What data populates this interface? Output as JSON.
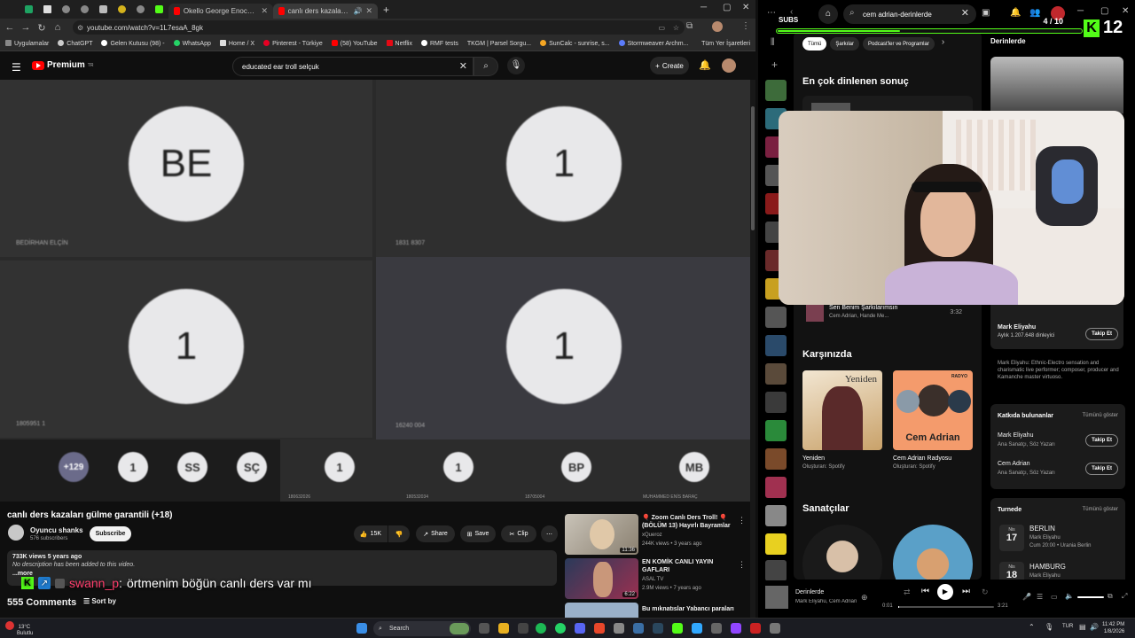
{
  "browser": {
    "tabs": [
      {
        "label": "Okello George Enock - YouTub"
      },
      {
        "label": "canlı ders kazaları gülme g"
      }
    ],
    "url": "youtube.com/watch?v=1L7esaA_8gk",
    "bookmarks": [
      "Uygulamalar",
      "ChatGPT",
      "Gelen Kutusu (98) -",
      "WhatsApp",
      "Home / X",
      "Pinterest - Türkiye",
      "(58) YouTube",
      "Netflix",
      "RMF tests",
      "TKGM | Parsel Sorgu...",
      "SunCalc - sunrise, s...",
      "Stormweaver Archm...",
      "Tüm Yer İşaretleri"
    ]
  },
  "youtube": {
    "logo": "Premium",
    "logo_sup": "TR",
    "search_value": "educated ear troll selçuk",
    "create_label": "Create",
    "meeting": {
      "tiles": [
        {
          "initials": "BE",
          "name": "BEDİRHAN ELÇİN"
        },
        {
          "initials": "1",
          "name": "1831 8307"
        },
        {
          "initials": "1",
          "name": "1805951 1"
        },
        {
          "initials": "1",
          "name": "16240 004"
        }
      ],
      "strip": [
        {
          "initials": "+129",
          "name": ""
        },
        {
          "initials": "1",
          "name": ""
        },
        {
          "initials": "SS",
          "name": ""
        },
        {
          "initials": "SÇ",
          "name": ""
        },
        {
          "initials": "1",
          "name": "180632026"
        },
        {
          "initials": "1",
          "name": "180532034"
        },
        {
          "initials": "BP",
          "name": "18705004"
        },
        {
          "initials": "MB",
          "name": "MUHAMMED ENİS BARAÇ"
        }
      ]
    },
    "video_title": "canlı ders kazaları gülme garantili (+18)",
    "channel_name": "Oyuncu shanks",
    "channel_subs": "576 subscribers",
    "subscribe_label": "Subscribe",
    "like_count": "15K",
    "share_label": "Share",
    "save_label": "Save",
    "clip_label": "Clip",
    "desc_stats": "733K views  5 years ago",
    "desc_text": "No description has been added to this video.",
    "desc_more": "...more",
    "comments_count": "555 Comments",
    "sort_label": "Sort by",
    "recommendations": [
      {
        "title": "🎈 Zoom Canlı Ders Troll! 🎈 (BÖLÜM 13) Hayırlı Bayramlar",
        "channel": "xQueroz",
        "views": "244K views • 3 years ago",
        "duration": "11:36"
      },
      {
        "title": "EN KOMİK CANLI YAYIN GAFLARI",
        "channel": "ASAL TV",
        "views": "2.9M views • 7 years ago",
        "duration": "6:22"
      },
      {
        "title": "Bu mıknatıslar Yabancı paraları",
        "channel": "",
        "views": "",
        "duration": ""
      }
    ]
  },
  "overlay": {
    "chat_user": "swann_p",
    "chat_message": "örtmenim böğün canlı ders var mı",
    "subs_label": "SUBS",
    "subs_count": "4 / 10",
    "subs_progress": 0.4,
    "kick_count": "12"
  },
  "spotify": {
    "search_value": "cem adrian-derinlerde",
    "chips": [
      "Tümü",
      "Şarkılar",
      "Podcast'ler ve Programlar"
    ],
    "top_result_heading": "En çok dinlenen sonuç",
    "track": {
      "title": "Sen Benim Şarkılarımsın",
      "artists": "Cem Adrian, Hande Me...",
      "duration": "3:32"
    },
    "featuring_heading": "Karşınızda",
    "cards": [
      {
        "title": "Yeniden",
        "subtitle": "Oluşturan: Spotify",
        "cover_text": "Yeniden"
      },
      {
        "title": "Cem Adrian Radyosu",
        "subtitle": "Oluşturan: Spotify",
        "cover_text": "Cem Adrian",
        "cover_tag": "RADYO"
      }
    ],
    "artists_heading": "Sanatçılar",
    "right_panel": {
      "heading": "Derinlerde",
      "artist": "Mark Eliyahu",
      "listeners": "Aylık 1.207.648 dinleyici",
      "follow_label": "Takip Et",
      "bio": "Mark Eliyahu: Ethnic-Electro sensation and charismatic live performer; composer, producer and Kamanche master virtuoso.",
      "credits_heading": "Katkıda bulunanlar",
      "show_all": "Tümünü göster",
      "credits": [
        {
          "name": "Mark Eliyahu",
          "role": "Ana Sanatçı, Söz Yazarı"
        },
        {
          "name": "Cem Adrian",
          "role": "Ana Sanatçı, Söz Yazarı"
        }
      ],
      "tour_heading": "Turnede",
      "tour": [
        {
          "month": "Nis",
          "day": "17",
          "city": "BERLIN",
          "artist": "Mark Eliyahu",
          "info": "Cum 20:00 • Urania Berlin"
        },
        {
          "month": "Nis",
          "day": "18",
          "city": "HAMBURG",
          "artist": "Mark Eliyahu",
          "info": ""
        }
      ]
    },
    "now_playing": {
      "title": "Derinlerde",
      "artists": "Mark Eliyahu, Cem Adrian",
      "elapsed": "0:01",
      "total": "3:21"
    }
  },
  "taskbar": {
    "weather_temp": "13°C",
    "weather_desc": "Bulutlu",
    "search_label": "Search",
    "lang": "TUR",
    "time": "11:42 PM",
    "date": "1/8/2026"
  }
}
